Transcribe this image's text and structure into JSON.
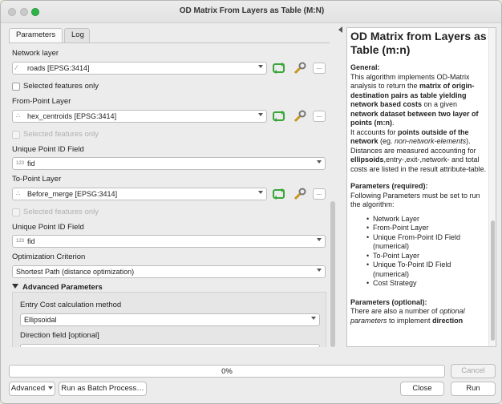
{
  "window": {
    "title": "OD Matrix From Layers as Table (M:N)"
  },
  "tabs": [
    {
      "label": "Parameters"
    },
    {
      "label": "Log"
    }
  ],
  "params": {
    "network_layer": {
      "label": "Network layer",
      "value": "roads [EPSG:3414]",
      "selected_only": "Selected features only"
    },
    "from_layer": {
      "label": "From-Point Layer",
      "value": "hex_centroids [EPSG:3414]",
      "selected_only": "Selected features only"
    },
    "from_id": {
      "label": "Unique Point ID Field",
      "value": "fid",
      "type_badge": "123"
    },
    "to_layer": {
      "label": "To-Point Layer",
      "value": "Before_merge [EPSG:3414]",
      "selected_only": "Selected features only"
    },
    "to_id": {
      "label": "Unique Point ID Field",
      "value": "fid",
      "type_badge": "123"
    },
    "optimization": {
      "label": "Optimization Criterion",
      "value": "Shortest Path (distance optimization)"
    },
    "advanced": {
      "header": "Advanced Parameters",
      "entry_cost": {
        "label": "Entry Cost calculation method",
        "value": "Ellipsoidal"
      },
      "direction": {
        "label": "Direction field [optional]"
      }
    },
    "more_button": "..."
  },
  "help": {
    "title": "OD Matrix from Layers as Table (m:n)",
    "general_heading": "General:",
    "general_text_1": "This algorithm implements OD-Matrix analysis to return the ",
    "general_bold_1": "matrix of origin-destination pairs as table yielding network based costs",
    "general_text_2": " on a given ",
    "general_bold_2": "network dataset between two layer of points (m:n)",
    "general_text_3": ".",
    "general_text_4": "It accounts for ",
    "general_bold_3": "points outside of the network",
    "general_text_5": " (eg. ",
    "general_italic_1": "non-network-elements",
    "general_text_6": "). Distances are measured accounting for ",
    "general_bold_4": "ellipsoids",
    "general_text_7": ",entry-,exit-,network- and total costs are listed in the result attribute-table.",
    "required_heading": "Parameters (required):",
    "required_text": "Following Parameters must be set to run the algorithm:",
    "required_items": [
      "Network Layer",
      "From-Point Layer",
      "Unique From-Point ID Field (numerical)",
      "To-Point Layer",
      "Unique To-Point ID Field (numerical)",
      "Cost Strategy"
    ],
    "optional_heading": "Parameters (optional):",
    "optional_text_1": "There are also a number of ",
    "optional_italic": "optional parameters",
    "optional_text_2": " to implement ",
    "optional_bold": "direction"
  },
  "footer": {
    "progress_text": "0%",
    "progress_value": 0,
    "cancel": "Cancel",
    "advanced": "Advanced",
    "batch": "Run as Batch Process…",
    "close": "Close",
    "run": "Run"
  },
  "colors": {
    "run_icon_green": "#3aa63a",
    "titlebar": "#e6e6e6"
  }
}
